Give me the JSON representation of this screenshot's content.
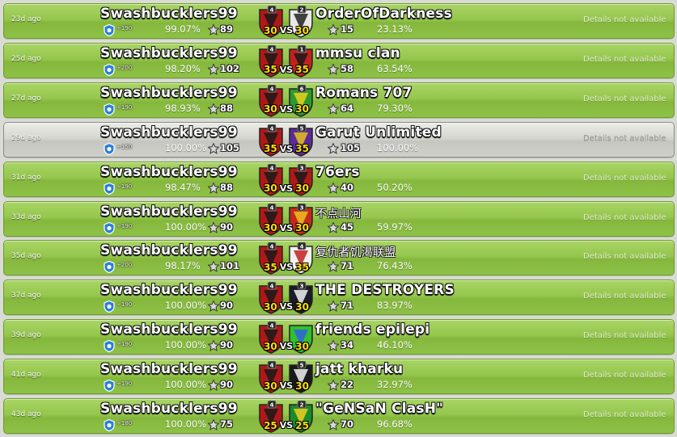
{
  "labels": {
    "vs": "VS",
    "details": "Details not available"
  },
  "wars": [
    {
      "ago": "23d ago",
      "our_name": "Swashbucklers99",
      "trophies": "+190",
      "our_pct": "99.07%",
      "our_stars": "89",
      "our_level": "4",
      "size": "30",
      "opp_name": "OrderOfDarkness",
      "opp_level": "2",
      "opp_stars": "15",
      "opp_pct": "23.13%",
      "opp_badge": {
        "primary": "#e8e8e8",
        "secondary": "#222222"
      },
      "result": "win"
    },
    {
      "ago": "25d ago",
      "our_name": "Swashbucklers99",
      "trophies": "+200",
      "our_pct": "98.20%",
      "our_stars": "102",
      "our_level": "4",
      "size": "35",
      "opp_name": "mmsu clan",
      "opp_level": "1",
      "opp_stars": "58",
      "opp_pct": "63.54%",
      "opp_badge": {
        "primary": "#c42020",
        "secondary": "#1a1a1a"
      },
      "result": "win"
    },
    {
      "ago": "27d ago",
      "our_name": "Swashbucklers99",
      "trophies": "+190",
      "our_pct": "98.93%",
      "our_stars": "88",
      "our_level": "4",
      "size": "30",
      "opp_name": "Romans 707",
      "opp_level": "6",
      "opp_stars": "64",
      "opp_pct": "79.30%",
      "opp_badge": {
        "primary": "#2e9a2e",
        "secondary": "#e8d21a"
      },
      "result": "win"
    },
    {
      "ago": "29d ago",
      "our_name": "Swashbucklers99",
      "trophies": "+150",
      "our_pct": "100.00%",
      "our_stars": "105",
      "our_level": "4",
      "size": "35",
      "opp_name": "Garut Unlimited",
      "opp_level": "5",
      "opp_stars": "105",
      "opp_pct": "100.00%",
      "opp_badge": {
        "primary": "#5a2a9a",
        "secondary": "#e8c21a"
      },
      "result": "draw"
    },
    {
      "ago": "31d ago",
      "our_name": "Swashbucklers99",
      "trophies": "+190",
      "our_pct": "98.47%",
      "our_stars": "88",
      "our_level": "4",
      "size": "30",
      "opp_name": "76ers",
      "opp_level": "3",
      "opp_stars": "40",
      "opp_pct": "50.20%",
      "opp_badge": {
        "primary": "#b01818",
        "secondary": "#1a1a1a"
      },
      "result": "win"
    },
    {
      "ago": "33d ago",
      "our_name": "Swashbucklers99",
      "trophies": "+190",
      "our_pct": "100.00%",
      "our_stars": "90",
      "our_level": "4",
      "size": "30",
      "opp_name": "不点山河",
      "opp_level": "3",
      "opp_stars": "45",
      "opp_pct": "59.97%",
      "opp_badge": {
        "primary": "#c42a1a",
        "secondary": "#f0c020"
      },
      "result": "win"
    },
    {
      "ago": "35d ago",
      "our_name": "Swashbucklers99",
      "trophies": "+200",
      "our_pct": "98.17%",
      "our_stars": "101",
      "our_level": "4",
      "size": "35",
      "opp_name": "复仇者饥渴联盟",
      "opp_level": "4",
      "opp_stars": "71",
      "opp_pct": "76.43%",
      "opp_badge": {
        "primary": "#f2f2f2",
        "secondary": "#c42020"
      },
      "result": "win"
    },
    {
      "ago": "37d ago",
      "our_name": "Swashbucklers99",
      "trophies": "+190",
      "our_pct": "100.00%",
      "our_stars": "90",
      "our_level": "4",
      "size": "30",
      "opp_name": "THE DESTROYERS",
      "opp_level": "3",
      "opp_stars": "71",
      "opp_pct": "83.97%",
      "opp_badge": {
        "primary": "#1a1a2a",
        "secondary": "#f2f2f2"
      },
      "result": "win"
    },
    {
      "ago": "39d ago",
      "our_name": "Swashbucklers99",
      "trophies": "+190",
      "our_pct": "100.00%",
      "our_stars": "90",
      "our_level": "4",
      "size": "30",
      "opp_name": "friends epilepi",
      "opp_level": "",
      "opp_stars": "34",
      "opp_pct": "46.10%",
      "opp_badge": {
        "primary": "#30c030",
        "secondary": "#3060e0"
      },
      "result": "win"
    },
    {
      "ago": "41d ago",
      "our_name": "Swashbucklers99",
      "trophies": "+190",
      "our_pct": "100.00%",
      "our_stars": "90",
      "our_level": "4",
      "size": "30",
      "opp_name": "jatt kharku",
      "opp_level": "5",
      "opp_stars": "22",
      "opp_pct": "32.97%",
      "opp_badge": {
        "primary": "#1a1a1a",
        "secondary": "#f2f2f2"
      },
      "result": "win"
    },
    {
      "ago": "43d ago",
      "our_name": "Swashbucklers99",
      "trophies": "+180",
      "our_pct": "100.00%",
      "our_stars": "75",
      "our_level": "4",
      "size": "25",
      "opp_name": "\"GeNSaN ClasH\"",
      "opp_level": "2",
      "opp_stars": "70",
      "opp_pct": "96.68%",
      "opp_badge": {
        "primary": "#1a8a2a",
        "secondary": "#f0d020"
      },
      "result": "win"
    }
  ],
  "colors": {
    "win_row": "#95c64d",
    "draw_row": "#d6d6d0",
    "our_badge": "#b01818",
    "vs_number": "#ffe000"
  }
}
